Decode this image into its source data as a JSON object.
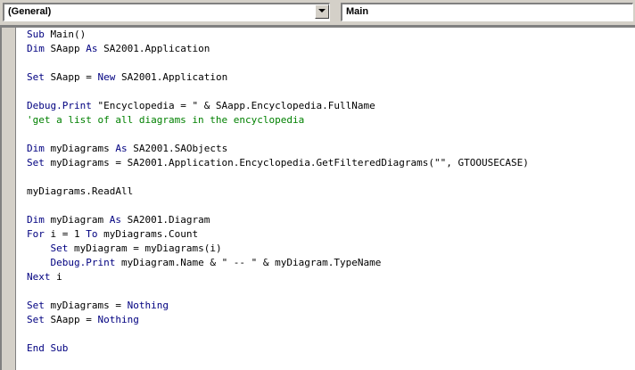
{
  "toolbar": {
    "object_combo_value": "(General)",
    "procedure_combo_value": "Main"
  },
  "colors": {
    "keyword": "#000080",
    "comment": "#008000",
    "text": "#000000",
    "background": "#ffffff",
    "chrome": "#d4d0c8"
  },
  "code_lines": [
    [
      {
        "k": "kw",
        "t": "Sub"
      },
      {
        "k": "",
        "t": " Main()"
      }
    ],
    [
      {
        "k": "kw",
        "t": "Dim"
      },
      {
        "k": "",
        "t": " SAapp "
      },
      {
        "k": "kw",
        "t": "As"
      },
      {
        "k": "",
        "t": " SA2001.Application"
      }
    ],
    [],
    [
      {
        "k": "kw",
        "t": "Set"
      },
      {
        "k": "",
        "t": " SAapp = "
      },
      {
        "k": "kw",
        "t": "New"
      },
      {
        "k": "",
        "t": " SA2001.Application"
      }
    ],
    [],
    [
      {
        "k": "kw",
        "t": "Debug.Print"
      },
      {
        "k": "",
        "t": " \"Encyclopedia = \" & SAapp.Encyclopedia.FullName"
      }
    ],
    [
      {
        "k": "cm",
        "t": "'get a list of all diagrams in the encyclopedia"
      }
    ],
    [],
    [
      {
        "k": "kw",
        "t": "Dim"
      },
      {
        "k": "",
        "t": " myDiagrams "
      },
      {
        "k": "kw",
        "t": "As"
      },
      {
        "k": "",
        "t": " SA2001.SAObjects"
      }
    ],
    [
      {
        "k": "kw",
        "t": "Set"
      },
      {
        "k": "",
        "t": " myDiagrams = SA2001.Application.Encyclopedia.GetFilteredDiagrams(\"\", GTOOUSECASE)"
      }
    ],
    [],
    [
      {
        "k": "",
        "t": "myDiagrams.ReadAll"
      }
    ],
    [],
    [
      {
        "k": "kw",
        "t": "Dim"
      },
      {
        "k": "",
        "t": " myDiagram "
      },
      {
        "k": "kw",
        "t": "As"
      },
      {
        "k": "",
        "t": " SA2001.Diagram"
      }
    ],
    [
      {
        "k": "kw",
        "t": "For"
      },
      {
        "k": "",
        "t": " i = 1 "
      },
      {
        "k": "kw",
        "t": "To"
      },
      {
        "k": "",
        "t": " myDiagrams.Count"
      }
    ],
    [
      {
        "k": "",
        "t": "    "
      },
      {
        "k": "kw",
        "t": "Set"
      },
      {
        "k": "",
        "t": " myDiagram = myDiagrams(i)"
      }
    ],
    [
      {
        "k": "",
        "t": "    "
      },
      {
        "k": "kw",
        "t": "Debug.Print"
      },
      {
        "k": "",
        "t": " myDiagram.Name & \" -- \" & myDiagram.TypeName"
      }
    ],
    [
      {
        "k": "kw",
        "t": "Next"
      },
      {
        "k": "",
        "t": " i"
      }
    ],
    [],
    [
      {
        "k": "kw",
        "t": "Set"
      },
      {
        "k": "",
        "t": " myDiagrams = "
      },
      {
        "k": "kw",
        "t": "Nothing"
      }
    ],
    [
      {
        "k": "kw",
        "t": "Set"
      },
      {
        "k": "",
        "t": " SAapp = "
      },
      {
        "k": "kw",
        "t": "Nothing"
      }
    ],
    [],
    [
      {
        "k": "kw",
        "t": "End Sub"
      }
    ]
  ]
}
